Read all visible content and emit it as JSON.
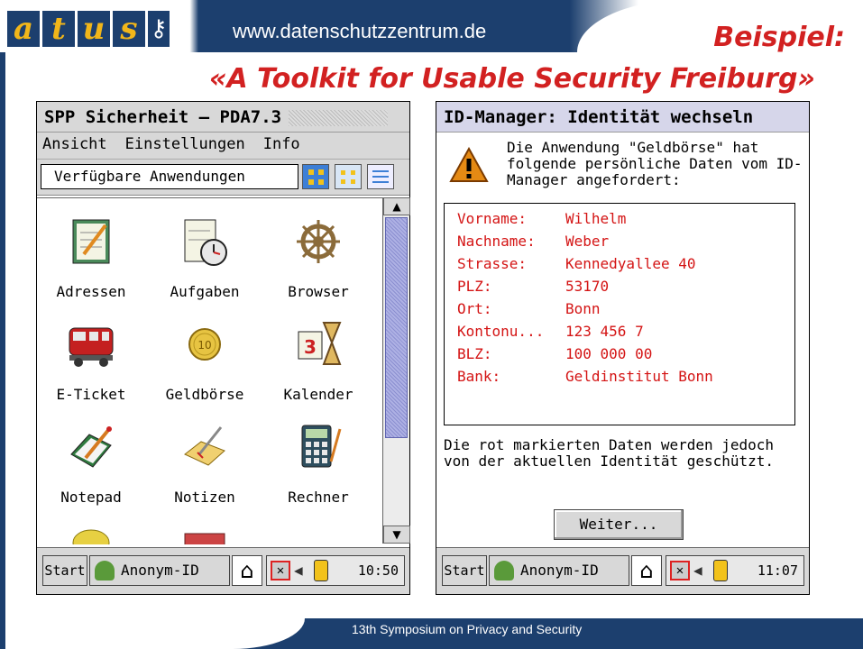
{
  "header": {
    "logo_text": "atus",
    "url": "www.datenschutzzentrum.de",
    "title_line1": "Beispiel:",
    "title_line2": "«A Toolkit for Usable Security Freiburg»"
  },
  "left_window": {
    "title": "SPP Sicherheit – PDA7.3",
    "menu": [
      "Ansicht",
      "Einstellungen",
      "Info"
    ],
    "view_select": "Verfügbare Anwendungen",
    "apps": [
      {
        "label": "Adressen",
        "icon": "address-book-icon"
      },
      {
        "label": "Aufgaben",
        "icon": "tasks-icon"
      },
      {
        "label": "Browser",
        "icon": "ship-wheel-icon"
      },
      {
        "label": "E-Ticket",
        "icon": "train-icon"
      },
      {
        "label": "Geldbörse",
        "icon": "coin-icon"
      },
      {
        "label": "Kalender",
        "icon": "calendar-hourglass-icon"
      },
      {
        "label": "Notepad",
        "icon": "notepad-icon"
      },
      {
        "label": "Notizen",
        "icon": "notes-icon"
      },
      {
        "label": "Rechner",
        "icon": "calculator-icon"
      }
    ],
    "taskbar": {
      "start": "Start",
      "identity": "Anonym-ID",
      "time": "10:50"
    }
  },
  "right_window": {
    "title": "ID-Manager: Identität wechseln",
    "message": "Die Anwendung \"Geldbörse\" hat folgende persönliche Daten vom ID-Manager angefordert:",
    "fields": [
      {
        "key": "Vorname:",
        "value": "Wilhelm"
      },
      {
        "key": "Nachname:",
        "value": "Weber"
      },
      {
        "key": "Strasse:",
        "value": "Kennedyallee 40"
      },
      {
        "key": "PLZ:",
        "value": "53170"
      },
      {
        "key": "Ort:",
        "value": "Bonn"
      },
      {
        "key": "Kontonu...",
        "value": "123 456 7"
      },
      {
        "key": "BLZ:",
        "value": "100 000 00"
      },
      {
        "key": "Bank:",
        "value": "Geldinstitut Bonn"
      }
    ],
    "note": "Die rot markierten Daten werden jedoch von der aktuellen Identität geschützt.",
    "button": "Weiter...",
    "taskbar": {
      "start": "Start",
      "identity": "Anonym-ID",
      "time": "11:07"
    }
  },
  "footer": {
    "text": "13th Symposium on Privacy and Security"
  },
  "colors": {
    "navy": "#1c3f6e",
    "title_red": "#d22121",
    "data_red": "#d41414",
    "scroll_blue": "#9b9fda"
  }
}
